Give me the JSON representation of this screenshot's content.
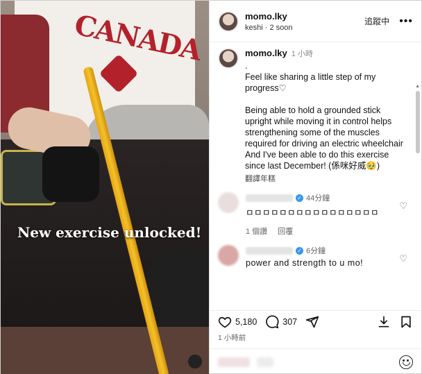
{
  "media": {
    "caption": "New exercise unlocked!"
  },
  "header": {
    "username": "momo.lky",
    "subtitle": "keshi · 2 soon",
    "following_label": "追蹤中",
    "more_icon": "more-icon"
  },
  "post": {
    "username": "momo.lky",
    "time": "1 小時",
    "text": ".\nFeel like sharing a little step of my progress♡\n\nBeing able to hold a grounded stick upright while moving it in control helps strengthening some of the muscles required for driving an electric wheelchair\nAnd I've been able to do this exercise since last December! (係咪好威🥹)",
    "translate_label": "翻譯年糕"
  },
  "comments": [
    {
      "time": "44分鐘",
      "text": "ㅁㅁㅁㅁㅁㅁㅁㅁㅁㅁㅁㅁㅁㅁㅁㅁ",
      "likes_label": "1 個讚",
      "reply_label": "回覆"
    },
    {
      "time": "6分鐘",
      "text": "power and strength to u mo!"
    }
  ],
  "actions": {
    "likes_count": "5,180",
    "comments_count": "307"
  },
  "date_label": "1 小時前",
  "colors": {
    "verified": "#3897f0",
    "stick": "#f2c22a",
    "caption": "#ffffff"
  }
}
